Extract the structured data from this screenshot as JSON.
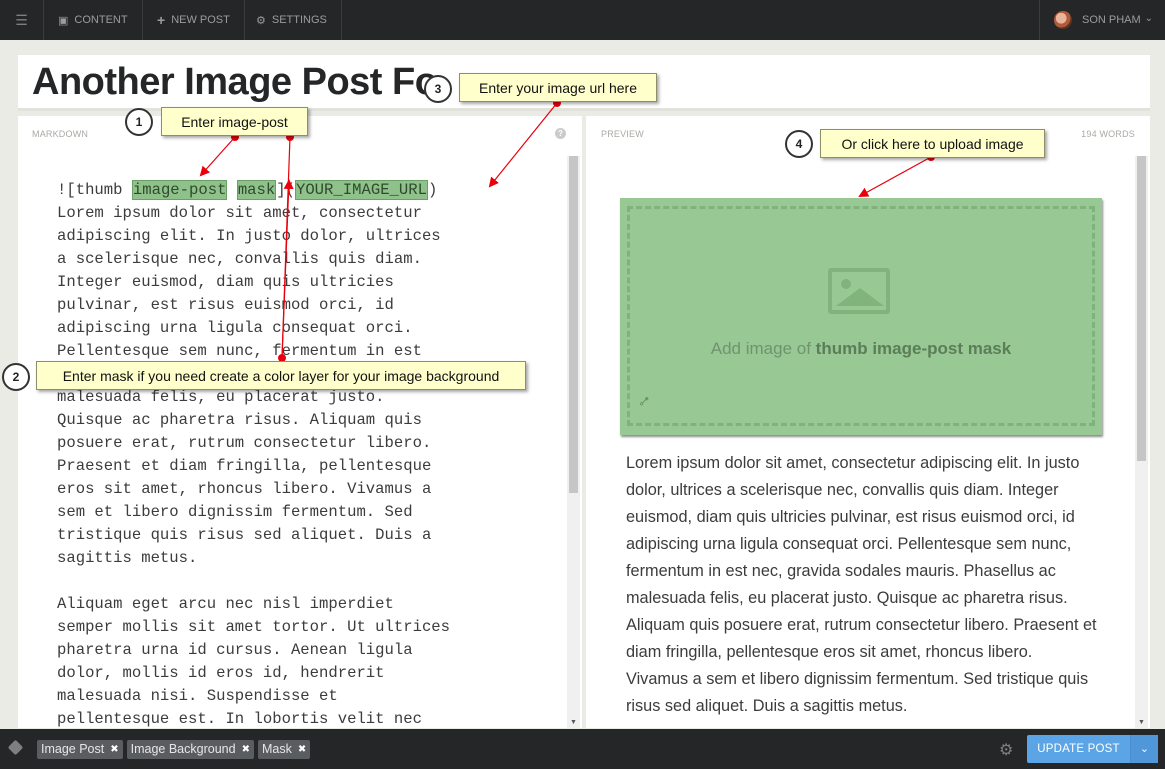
{
  "topbar": {
    "nav": [
      {
        "label": "CONTENT",
        "icon": "content-icon"
      },
      {
        "label": "NEW POST",
        "icon": "plus-icon"
      },
      {
        "label": "SETTINGS",
        "icon": "gear-icon"
      }
    ],
    "user_name": "SON PHAM"
  },
  "post": {
    "title": "Another Image Post Fo"
  },
  "editor": {
    "label": "MARKDOWN",
    "help": "?",
    "syntax": {
      "prefix": "![thumb ",
      "class1": "image-post",
      "class2": "mask",
      "mid": "](",
      "url": "YOUR_IMAGE_URL",
      "suffix": ")"
    },
    "body": "Lorem ipsum dolor sit amet, consectetur\nadipiscing elit. In justo dolor, ultrices\na scelerisque nec, convallis quis diam.\nInteger euismod, diam quis ultricies\npulvinar, est risus euismod orci, id\nadipiscing urna ligula consequat orci.\nPellentesque sem nunc, fermentum in est\nnec, gravida sodales mauris. Phasellus ac\nmalesuada felis, eu placerat justo.\nQuisque ac pharetra risus. Aliquam quis\nposuere erat, rutrum consectetur libero.\nPraesent et diam fringilla, pellentesque\neros sit amet, rhoncus libero. Vivamus a\nsem et libero dignissim fermentum. Sed\ntristique quis risus sed aliquet. Duis a\nsagittis metus.\n\nAliquam eget arcu nec nisl imperdiet\nsemper mollis sit amet tortor. Ut ultrices\npharetra urna id cursus. Aenean ligula\ndolor, mollis id eros id, hendrerit\nmalesuada nisi. Suspendisse et\npellentesque est. In lobortis velit nec"
  },
  "preview": {
    "label": "PREVIEW",
    "word_count": "194 WORDS",
    "image_caption_prefix": "Add image of ",
    "image_caption_bold": "thumb image-post mask",
    "text": "Lorem ipsum dolor sit amet, consectetur adipiscing elit. In justo dolor, ultrices a scelerisque nec, convallis quis diam. Integer euismod, diam quis ultricies pulvinar, est risus euismod orci, id adipiscing urna ligula consequat orci. Pellentesque sem nunc, fermentum in est nec, gravida sodales mauris. Phasellus ac malesuada felis, eu placerat justo. Quisque ac pharetra risus. Aliquam quis posuere erat, rutrum consectetur libero. Praesent et diam fringilla, pellentesque eros sit amet, rhoncus libero. Vivamus a sem et libero dignissim fermentum. Sed tristique quis risus sed aliquet. Duis a sagittis metus."
  },
  "bottombar": {
    "tags": [
      "Image Post",
      "Image Background",
      "Mask"
    ],
    "update_label": "UPDATE POST"
  },
  "annotations": [
    {
      "num": "1",
      "text": "Enter image-post"
    },
    {
      "num": "2",
      "text": "Enter mask if you need create a color layer for your image background"
    },
    {
      "num": "3",
      "text": "Enter your image url here"
    },
    {
      "num": "4",
      "text": "Or click here to upload image"
    }
  ],
  "colors": {
    "accent": "#5ba4e5",
    "highlight": "#8fc18b",
    "note_bg": "#ffffcc",
    "arrow": "#e8000b"
  }
}
